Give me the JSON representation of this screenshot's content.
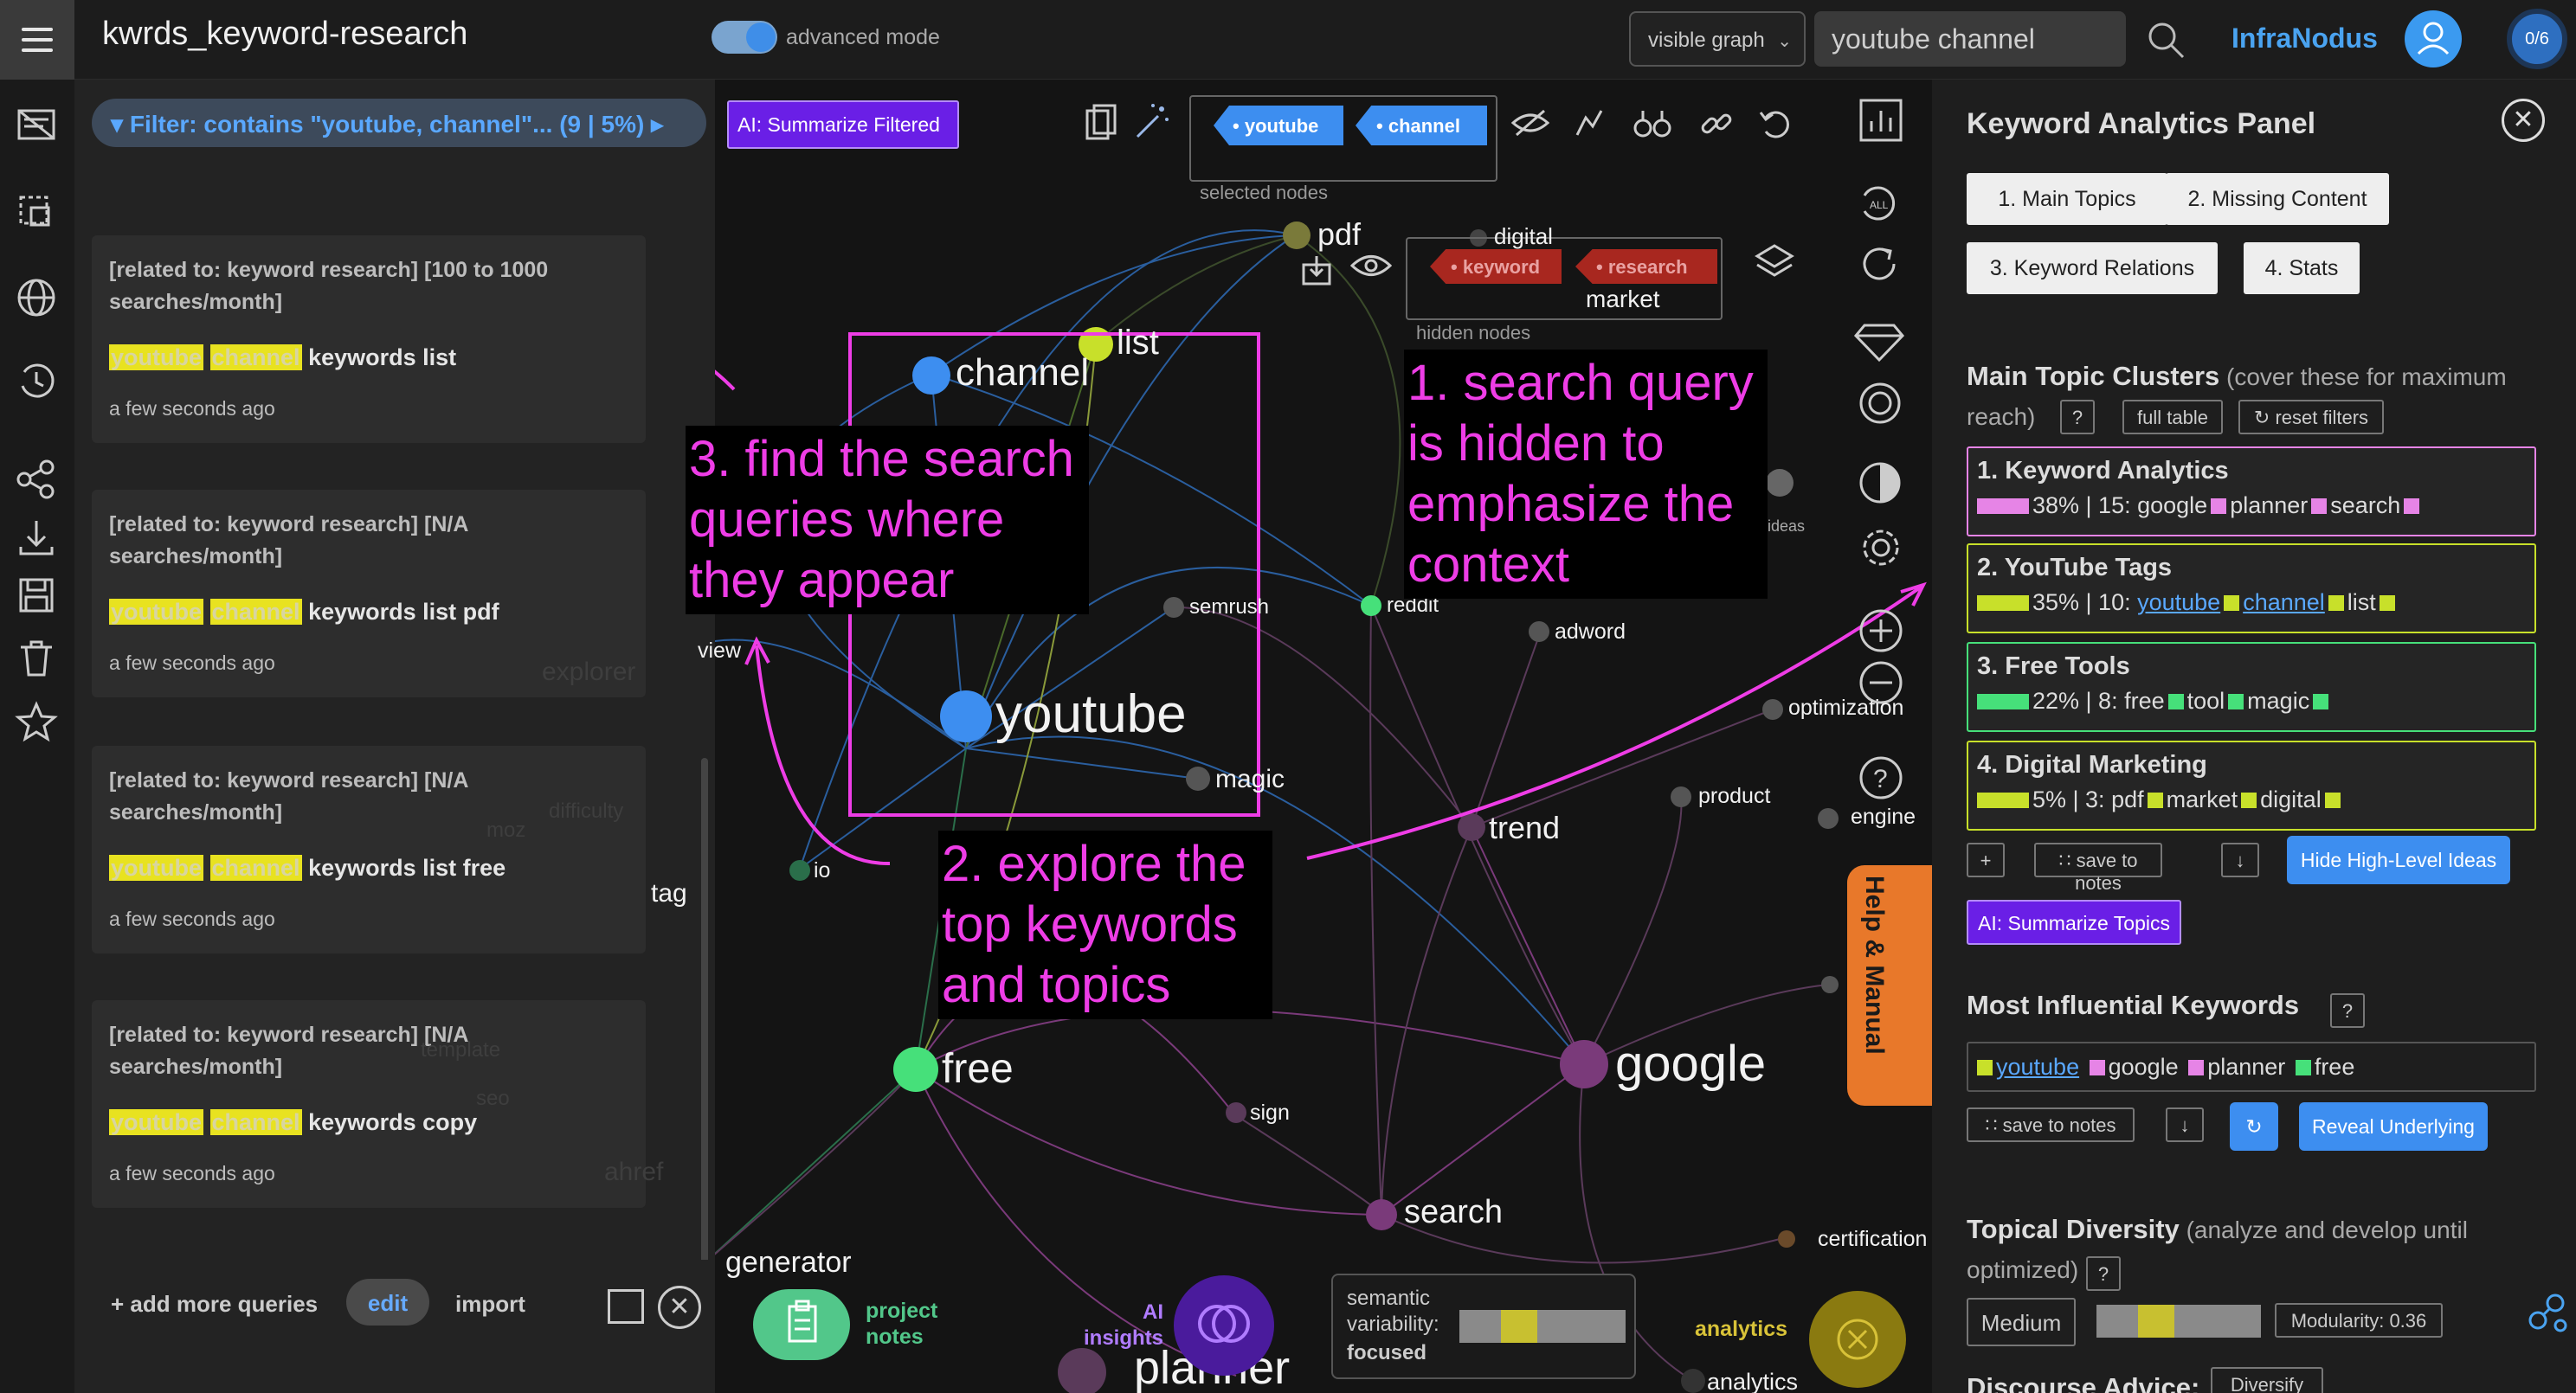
{
  "app": {
    "title": "kwrds_keyword-research",
    "brand": "InfraNodus",
    "counter": "0/6"
  },
  "topbar": {
    "mode_label": "advanced mode",
    "graph_select": "visible graph",
    "search_value": "youtube channel"
  },
  "filter": {
    "label": "Filter: contains \"youtube, channel\"... (9 | 5%)",
    "ai_summarize": "AI: Summarize Filtered"
  },
  "queries": [
    {
      "meta": "[related to: keyword research] [100 to 1000 searches/month]",
      "hl1": "youtube",
      "hl2": "channel",
      "rest": "keywords list",
      "time": "a few seconds ago"
    },
    {
      "meta": "[related to: keyword research] [N/A searches/month]",
      "hl1": "youtube",
      "hl2": "channel",
      "rest": "keywords list pdf",
      "time": "a few seconds ago"
    },
    {
      "meta": "[related to: keyword research] [N/A searches/month]",
      "hl1": "youtube",
      "hl2": "channel",
      "rest": "keywords list free",
      "time": "a few seconds ago"
    },
    {
      "meta": "[related to: keyword research] [N/A searches/month]",
      "hl1": "youtube",
      "hl2": "channel",
      "rest": "keywords copy",
      "time": "a few seconds ago"
    }
  ],
  "query_footer": {
    "add_more": "+ add more queries",
    "edit": "edit",
    "import": "import"
  },
  "graph": {
    "selected_nodes_label": "selected nodes",
    "selected_nodes": [
      "youtube",
      "channel"
    ],
    "hidden_nodes_label": "hidden nodes",
    "hidden_nodes": [
      "keyword",
      "research"
    ],
    "nodes": {
      "pdf": "pdf",
      "digital": "digital",
      "market": "market",
      "list": "list",
      "channel": "channel",
      "youtube": "youtube",
      "semrush": "semrush",
      "reddit": "reddit",
      "adword": "adword",
      "magic": "magic",
      "view": "view",
      "explorer": "explorer",
      "optimization": "optimization",
      "product": "product",
      "engine": "engine",
      "trend": "trend",
      "difficulty": "difficulty",
      "moz": "moz",
      "tag": "tag",
      "io": "io",
      "template": "template",
      "seo": "seo",
      "free": "free",
      "sign": "sign",
      "google": "google",
      "ahref": "ahref",
      "search": "search",
      "generator": "generator",
      "certification": "certification",
      "analytics": "analytics",
      "planner": "planner",
      "ideas": "ideas",
      "analytics_right": "analytics"
    },
    "annotations": {
      "a1": "1. search query is hidden to emphasize the context",
      "a2": "2. explore the top keywords and topics",
      "a3": "3. find the search queries where they appear"
    },
    "project_notes": "project notes",
    "ai_insights": "AI insights",
    "semantic_label": "semantic variability:",
    "semantic_value": "focused",
    "help": "Help & Manual"
  },
  "panel": {
    "title": "Keyword Analytics Panel",
    "tabs": [
      "1. Main Topics",
      "2. Missing Content",
      "3. Keyword Relations",
      "4. Stats"
    ],
    "clusters_heading": "Main Topic Clusters",
    "clusters_sub": "(cover these for maximum reach)",
    "help_q": "?",
    "full_table": "full table",
    "reset_filters": "↻ reset filters",
    "clusters": [
      {
        "title": "1. Keyword Analytics",
        "pct": "38% | 15:",
        "words": [
          "google",
          "planner",
          "search"
        ],
        "color": "#e684e6",
        "links": false
      },
      {
        "title": "2. YouTube Tags",
        "pct": "35% | 10:",
        "words": [
          "youtube",
          "channel",
          "list"
        ],
        "color": "#c8e02a",
        "links": true
      },
      {
        "title": "3. Free Tools",
        "pct": "22% | 8:",
        "words": [
          "free",
          "tool",
          "magic"
        ],
        "color": "#46e07a",
        "links": false
      },
      {
        "title": "4. Digital Marketing",
        "pct": "5% | 3:",
        "words": [
          "pdf",
          "market",
          "digital"
        ],
        "color": "#c8e02a",
        "links": false
      }
    ],
    "plus": "+",
    "save_to_notes": "∷ save to notes",
    "download": "↓",
    "hide_high_level": "Hide High-Level Ideas",
    "ai_summarize_topics": "AI: Summarize Topics",
    "influential_heading": "Most Influential Keywords",
    "influential": [
      {
        "word": "youtube",
        "color": "#c8e02a",
        "link": true
      },
      {
        "word": "google",
        "color": "#e684e6",
        "link": false
      },
      {
        "word": "planner",
        "color": "#e684e6",
        "link": false
      },
      {
        "word": "free",
        "color": "#46e07a",
        "link": false
      }
    ],
    "reveal_underlying": "Reveal Underlying",
    "refresh": "↻",
    "diversity_heading": "Topical Diversity",
    "diversity_sub": "(analyze and develop until optimized)",
    "diversity_value": "Medium",
    "modularity": "Modularity: 0.36",
    "discourse_heading": "Discourse Advice:",
    "discourse_value": "Diversify"
  }
}
